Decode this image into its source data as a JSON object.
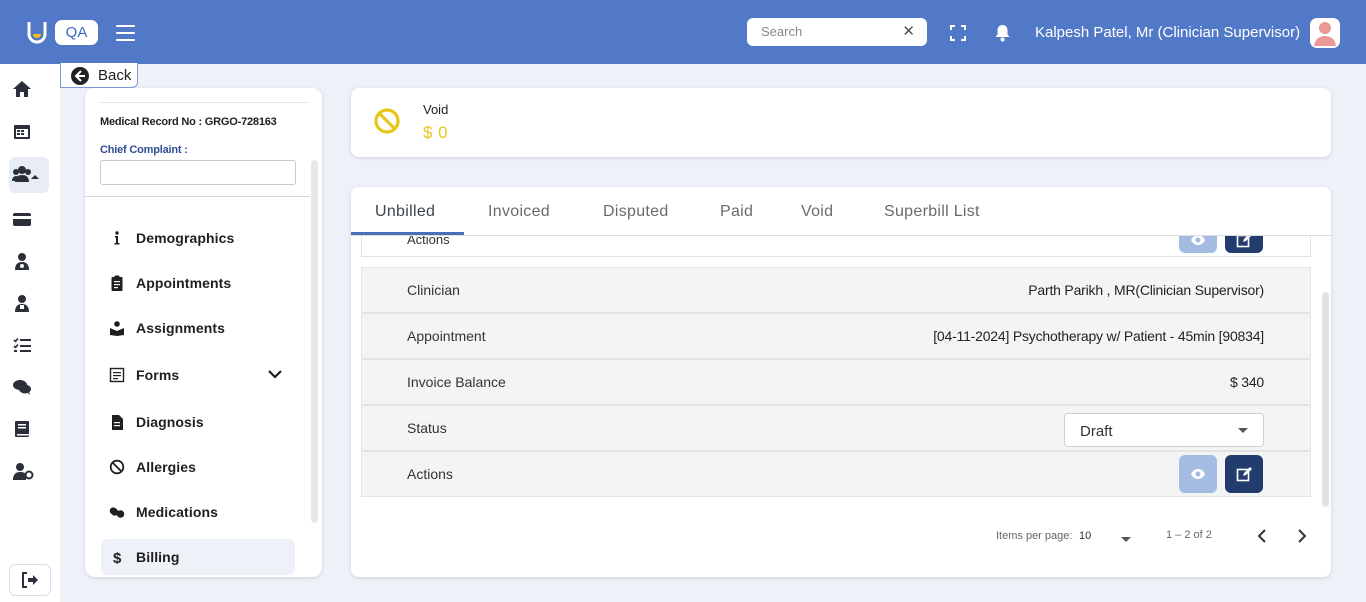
{
  "header": {
    "app_badge": "QA",
    "search_placeholder": "Search",
    "search_clear": "✕",
    "user_name": "Kalpesh Patel, Mr (Clinician Supervisor)"
  },
  "back_label": "Back",
  "patient": {
    "medical_record": "Medical Record No : GRGO-728163",
    "chief_complaint_label": "Chief Complaint :",
    "chief_complaint_value": ""
  },
  "patient_menu": [
    {
      "label": "Demographics",
      "icon": "info-icon"
    },
    {
      "label": "Appointments",
      "icon": "clipboard-icon"
    },
    {
      "label": "Assignments",
      "icon": "assignment-icon"
    },
    {
      "label": "Forms",
      "icon": "forms-icon"
    },
    {
      "label": "Diagnosis",
      "icon": "document-icon"
    },
    {
      "label": "Allergies",
      "icon": "ban-icon"
    },
    {
      "label": "Medications",
      "icon": "pills-icon"
    },
    {
      "label": "Billing",
      "icon": "dollar-icon"
    }
  ],
  "void_card": {
    "title": "Void",
    "amount": "$ 0",
    "accent": "#e6c61a"
  },
  "tabs": [
    "Unbilled",
    "Invoiced",
    "Disputed",
    "Paid",
    "Void",
    "Superbill List"
  ],
  "active_tab": "Unbilled",
  "partial_row_label": "Actions",
  "record": {
    "clinician_label": "Clinician",
    "clinician_value": "Parth Parikh , MR(Clinician Supervisor)",
    "appointment_label": "Appointment",
    "appointment_value": "[04-11-2024] Psychotherapy w/ Patient - 45min [90834]",
    "balance_label": "Invoice Balance",
    "balance_value": "$ 340",
    "status_label": "Status",
    "status_value": "Draft",
    "actions_label": "Actions"
  },
  "paginator": {
    "items_per_page_label": "Items per page:",
    "items_per_page": "10",
    "range": "1 – 2 of 2"
  },
  "colors": {
    "header_bg": "#5279c7",
    "edit_button": "#223c6e",
    "view_button": "#a4bbe2"
  }
}
